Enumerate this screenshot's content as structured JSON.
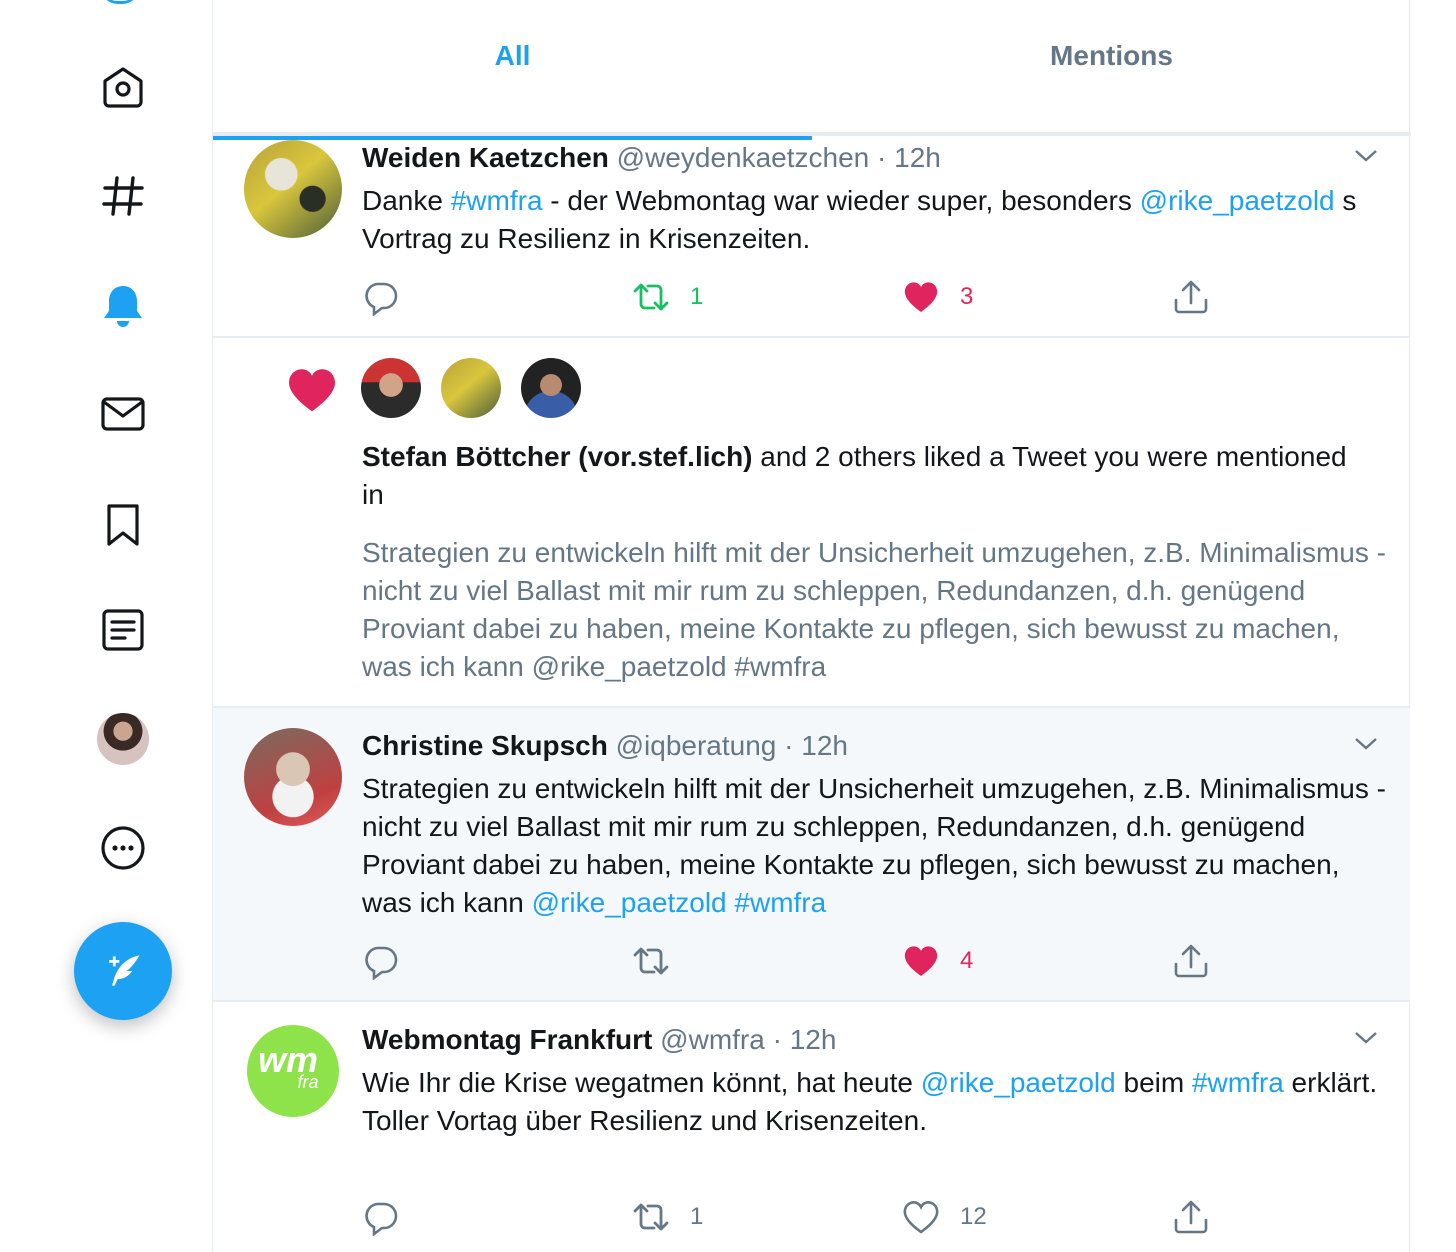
{
  "tabs": {
    "all": "All",
    "mentions": "Mentions"
  },
  "nav": {
    "items": [
      "home-icon",
      "explore-icon",
      "notifications-icon",
      "messages-icon",
      "bookmarks-icon",
      "lists-icon",
      "profile-avatar",
      "more-icon"
    ],
    "accent": "#1da1f2"
  },
  "tweet1": {
    "name": "Weiden Kaetzchen",
    "handle": "@weydenkaetzchen",
    "time": "· 12h",
    "t1": "Danke ",
    "l1": "#wmfra",
    "t2": " - der Webmontag war wieder super, besonders ",
    "l2": "@rike_paetzold",
    "t3": " s Vortrag zu Resilienz in Krisenzeiten.",
    "retweets": "1",
    "likes": "3"
  },
  "notification": {
    "actor": "Stefan Böttcher (vor.stef.lich)",
    "rest": " and 2 others liked a Tweet you were mentioned in",
    "quote": "Strategien zu entwickeln hilft mit der Unsicherheit umzugehen, z.B. Minimalismus - nicht zu viel Ballast mit mir rum zu schleppen, Redundanzen, d.h. genügend Proviant dabei zu haben, meine Kontakte zu pflegen, sich bewusst zu machen, was ich kann @rike_paetzold #wmfra"
  },
  "tweet2": {
    "name": "Christine Skupsch",
    "handle": "@iqberatung",
    "time": "· 12h",
    "t1": "Strategien zu entwickeln hilft mit der Unsicherheit umzugehen, z.B. Minimalismus - nicht zu viel Ballast mit mir rum zu schleppen, Redundanzen, d.h. genügend Proviant dabei zu haben, meine Kontakte zu pflegen, sich bewusst zu machen, was ich kann ",
    "l1": "@rike_paetzold",
    "t2": " ",
    "l2": "#wmfra",
    "likes": "4"
  },
  "tweet3": {
    "name": "Webmontag Frankfurt",
    "handle": "@wmfra",
    "time": "· 12h",
    "t1": "Wie Ihr die Krise wegatmen könnt, hat heute ",
    "l1": "@rike_paetzold",
    "t2": " beim ",
    "l2": "#wmfra",
    "t3": " erklärt.",
    "line2": "Toller Vortag über Resilienz und Krisenzeiten.",
    "retweets": "1",
    "likes": "12",
    "avatar_text": "wm",
    "avatar_sub": "fra"
  },
  "colors": {
    "like": "#e0245e",
    "retweet": "#17bf63",
    "link": "#1da1f2",
    "muted": "#657786"
  }
}
